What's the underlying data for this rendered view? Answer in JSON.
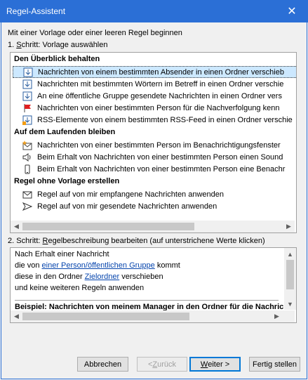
{
  "window": {
    "title": "Regel-Assistent",
    "close_label": "✕"
  },
  "intro": "Mit einer Vorlage oder einer leeren Regel beginnen",
  "step1": {
    "prefix": "1. ",
    "accel": "S",
    "rest": "chritt: Vorlage auswählen"
  },
  "sections": [
    {
      "heading": "Den Überblick behalten",
      "items": [
        {
          "icon": "envelope-folder-icon",
          "label": "Nachrichten von einem bestimmten Absender in einen Ordner verschieb",
          "selected": true
        },
        {
          "icon": "envelope-folder-icon",
          "label": "Nachrichten mit bestimmten Wörtern im Betreff in einen Ordner verschie",
          "selected": false
        },
        {
          "icon": "envelope-folder-icon",
          "label": "An eine öffentliche Gruppe gesendete Nachrichten in einen Ordner vers",
          "selected": false
        },
        {
          "icon": "red-flag-icon",
          "label": "Nachrichten von einer bestimmten Person für die Nachverfolgung kenn",
          "selected": false
        },
        {
          "icon": "rss-folder-icon",
          "label": "RSS-Elemente von einem bestimmten RSS-Feed in einen Ordner verschie",
          "selected": false
        }
      ]
    },
    {
      "heading": "Auf dem Laufenden bleiben",
      "items": [
        {
          "icon": "envelope-star-icon",
          "label": "Nachrichten von einer bestimmten Person im Benachrichtigungsfenster",
          "selected": false
        },
        {
          "icon": "speaker-icon",
          "label": "Beim Erhalt von Nachrichten von einer bestimmten Person einen Sound",
          "selected": false
        },
        {
          "icon": "mobile-phone-icon",
          "label": "Beim Erhalt von Nachrichten von einer bestimmten Person eine Benachr",
          "selected": false
        }
      ]
    },
    {
      "heading": "Regel ohne Vorlage erstellen",
      "items": [
        {
          "icon": "envelope-icon",
          "label": "Regel auf von mir empfangene Nachrichten anwenden",
          "selected": false
        },
        {
          "icon": "send-arrow-icon",
          "label": "Regel auf von mir gesendete Nachrichten anwenden",
          "selected": false
        }
      ]
    }
  ],
  "step2": {
    "prefix": "2. Schritt: ",
    "accel": "R",
    "rest": "egelbeschreibung bearbeiten (auf unterstrichene Werte klicken)"
  },
  "description": {
    "line1": "Nach Erhalt einer Nachricht",
    "line2_pre": "die von ",
    "line2_link": "einer Person/öffentlichen Gruppe",
    "line2_post": " kommt",
    "line3_pre": "diese in den Ordner ",
    "line3_link": "Zielordner",
    "line3_post": " verschieben",
    "line4": " und keine weiteren Regeln anwenden",
    "example": "Beispiel: Nachrichten von meinem Manager in den Ordner für die Nachricl"
  },
  "buttons": {
    "cancel": "Abbrechen",
    "back_arrow": "< ",
    "back_accel": "Z",
    "back_rest": "urück",
    "next_accel": "W",
    "next_rest": "eiter >",
    "finish": "Fertig stellen"
  }
}
